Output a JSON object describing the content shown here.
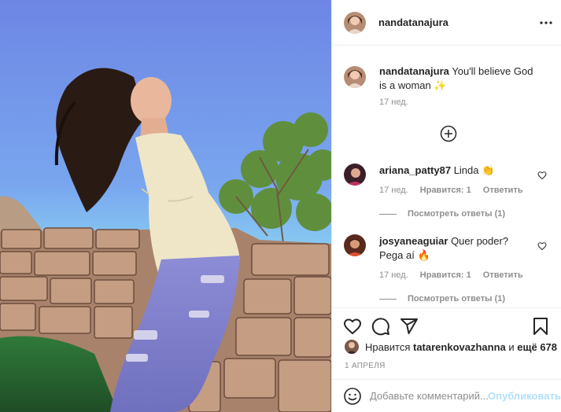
{
  "post": {
    "author": "nandatanajura",
    "more_icon": "more-horizontal-icon"
  },
  "caption": {
    "author": "nandatanajura",
    "text": "You'll believe God is a woman",
    "emoji": "✨",
    "time": "17 нед."
  },
  "load_more_icon": "plus-circle-icon",
  "comments": [
    {
      "author": "ariana_patty87",
      "text": "Linda",
      "emoji": "👏",
      "time": "17 нед.",
      "likes": "Нравится: 1",
      "reply": "Ответить",
      "view_replies": "Посмотреть ответы (1)"
    },
    {
      "author": "josyaneaguiar",
      "text": "Quer poder? Pega aí",
      "emoji": "🔥",
      "time": "17 нед.",
      "likes": "Нравится: 1",
      "reply": "Ответить",
      "view_replies": "Посмотреть ответы (1)"
    }
  ],
  "likes": {
    "prefix": "Нравится",
    "user": "tatarenkovazhanna",
    "middle": "и",
    "others": "ещё 678"
  },
  "date": "1 АПРЕЛЯ",
  "add_comment": {
    "placeholder": "Добавьте комментарий...",
    "publish": "Опубликовать"
  },
  "colors": {
    "text": "#262626",
    "muted": "#8e8e8e",
    "border": "#efefef",
    "publish_disabled": "#b2dffc",
    "sky": "#6f8fe6"
  }
}
